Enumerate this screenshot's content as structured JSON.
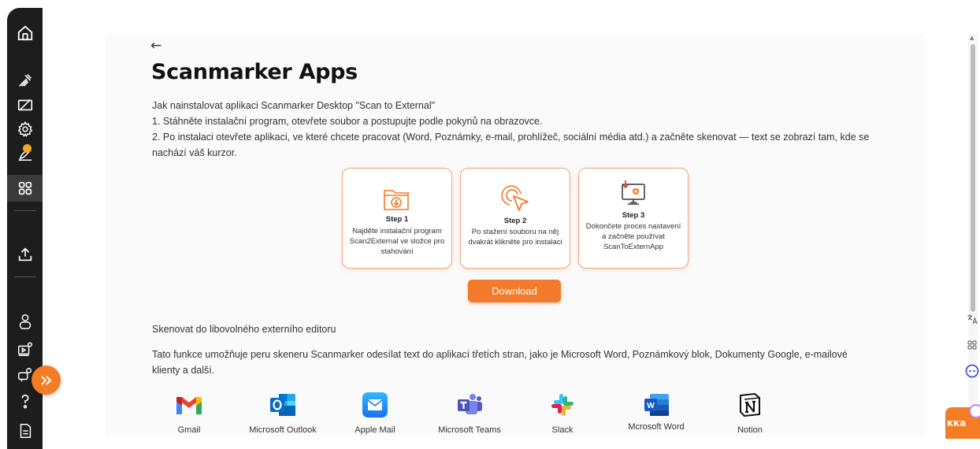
{
  "page": {
    "back_label": "←",
    "title": "Scanmarker Apps",
    "intro_heading": "Jak nainstalovat aplikaci Scanmarker Desktop \"Scan to External\"",
    "step_line_1": "1. Stáhněte instalační program, otevřete soubor a postupujte podle pokynů na obrazovce.",
    "step_line_2": "2. Po instalaci otevřete aplikaci, ve které chcete pracovat (Word, Poznámky, e-mail, prohlížeč, sociální média atd.) a začněte skenovat — text se zobrazí tam, kde se nachází váš kurzor."
  },
  "steps": [
    {
      "title": "Step 1",
      "desc": "Najděte instalační program Scan2External ve složce pro stahování",
      "icon": "folder-download-icon"
    },
    {
      "title": "Step 2",
      "desc": "Po stažení souboru na něj dvakrát klikněte pro instalaci",
      "icon": "cursor-click-icon"
    },
    {
      "title": "Step 3",
      "desc": "Dokončete proces nastavení a začněte používat ScanToExternApp",
      "icon": "monitor-settings-icon"
    }
  ],
  "download_label": "Download",
  "section": {
    "heading": "Skenovat do libovolného externího editoru",
    "desc": "Tato funkce umožňuje peru skeneru Scanmarker odesílat text do aplikací třetích stran, jako je Microsoft Word, Poznámkový blok, Dokumenty Google, e-mailové klienty a další."
  },
  "apps": [
    {
      "name": "Gmail",
      "icon": "gmail-icon"
    },
    {
      "name": "Microsoft Outlook",
      "icon": "outlook-icon"
    },
    {
      "name": "Apple Mail",
      "icon": "apple-mail-icon"
    },
    {
      "name": "Microsoft Teams",
      "icon": "teams-icon"
    },
    {
      "name": "Slack",
      "icon": "slack-icon"
    },
    {
      "name": "Mcrosoft Word",
      "icon": "word-icon"
    },
    {
      "name": "Notion",
      "icon": "notion-icon"
    }
  ],
  "chat_label": "кка",
  "colors": {
    "accent": "#f37a2a",
    "card_border": "#f1a47a",
    "sidebar": "#1d1d1d"
  }
}
